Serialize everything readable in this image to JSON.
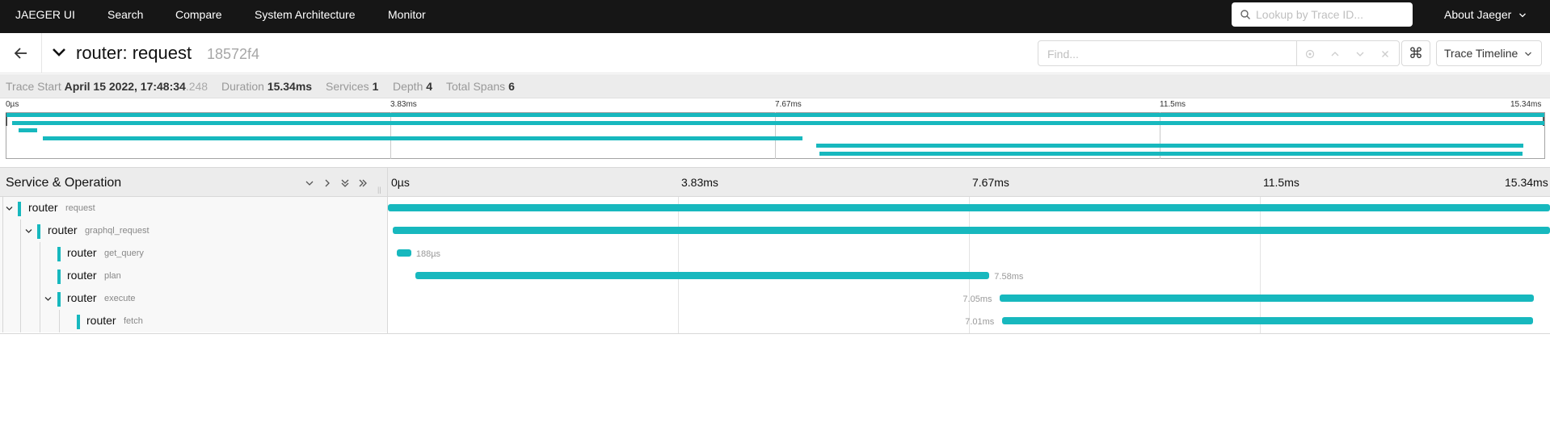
{
  "nav": {
    "brand": "JAEGER UI",
    "items": [
      "Search",
      "Compare",
      "System Architecture",
      "Monitor"
    ],
    "lookup_placeholder": "Lookup by Trace ID...",
    "about": "About Jaeger"
  },
  "trace": {
    "title": "router: request",
    "trace_id": "18572f4",
    "find_placeholder": "Find...",
    "view_select": "Trace Timeline",
    "kbd_glyph": "⌘"
  },
  "meta": {
    "trace_start_label": "Trace Start",
    "trace_start_value": "April 15 2022, 17:48:34",
    "trace_start_ms": ".248",
    "duration_label": "Duration",
    "duration_value": "15.34ms",
    "services_label": "Services",
    "services_value": "1",
    "depth_label": "Depth",
    "depth_value": "4",
    "total_spans_label": "Total Spans",
    "total_spans_value": "6"
  },
  "minimap_ticks": [
    "0µs",
    "3.83ms",
    "7.67ms",
    "11.5ms",
    "15.34ms"
  ],
  "timeline": {
    "header_title": "Service & Operation",
    "ticks": [
      "0µs",
      "3.83ms",
      "7.67ms",
      "11.5ms",
      "15.34ms"
    ]
  },
  "colors": {
    "span": "#17b8be",
    "nav_bg": "#161616"
  },
  "spans": [
    {
      "service": "router",
      "operation": "request",
      "depth": 0,
      "has_children": true,
      "start_ms": 0,
      "duration_ms": 15.34,
      "duration_label": ""
    },
    {
      "service": "router",
      "operation": "graphql_request",
      "depth": 1,
      "has_children": true,
      "start_ms": 0.06,
      "duration_ms": 15.28,
      "duration_label": ""
    },
    {
      "service": "router",
      "operation": "get_query",
      "depth": 2,
      "has_children": false,
      "start_ms": 0.12,
      "duration_ms": 0.188,
      "duration_label": "188µs"
    },
    {
      "service": "router",
      "operation": "plan",
      "depth": 2,
      "has_children": false,
      "start_ms": 0.36,
      "duration_ms": 7.58,
      "duration_label": "7.58ms"
    },
    {
      "service": "router",
      "operation": "execute",
      "depth": 2,
      "has_children": true,
      "start_ms": 8.08,
      "duration_ms": 7.05,
      "duration_label": "7.05ms"
    },
    {
      "service": "router",
      "operation": "fetch",
      "depth": 3,
      "has_children": false,
      "start_ms": 8.11,
      "duration_ms": 7.01,
      "duration_label": "7.01ms"
    }
  ]
}
